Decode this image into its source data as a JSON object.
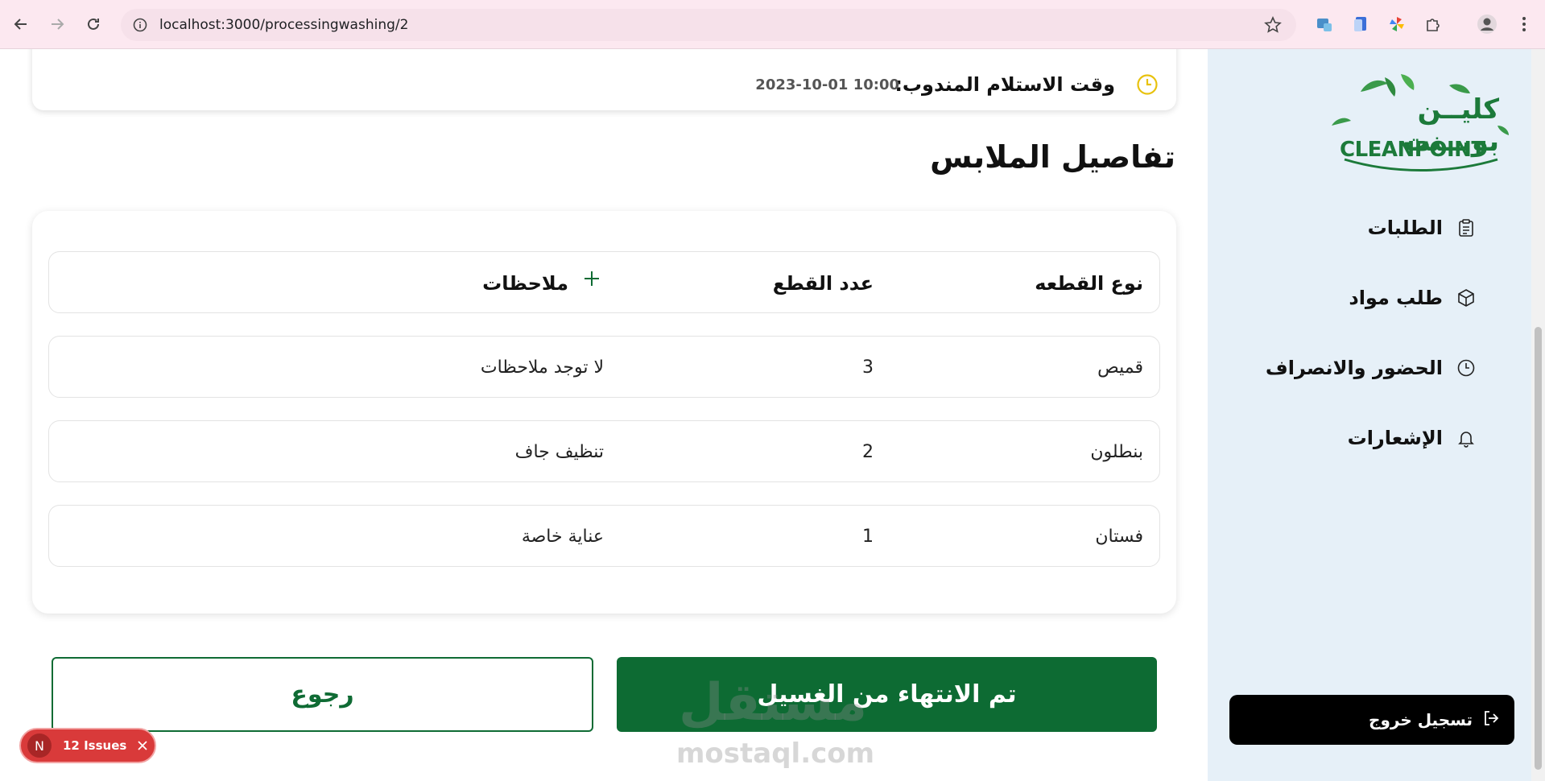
{
  "browser": {
    "url": "localhost:3000/processingwashing/2"
  },
  "pickup": {
    "label": "وقت الاستلام المندوب:",
    "value": "2023-10-01 10:00"
  },
  "section_title": "تفاصيل الملابس",
  "table": {
    "headers": {
      "type": "نوع القطعه",
      "count": "عدد القطع",
      "notes": "ملاحظات"
    },
    "rows": [
      {
        "type": "قميص",
        "count": "3",
        "notes": "لا توجد ملاحظات"
      },
      {
        "type": "بنطلون",
        "count": "2",
        "notes": "تنظيف جاف"
      },
      {
        "type": "فستان",
        "count": "1",
        "notes": "عناية خاصة"
      }
    ]
  },
  "buttons": {
    "back": "رجوع",
    "done": "تم الانتهاء من الغسيل"
  },
  "sidebar": {
    "logo_ar": "كليــن بويــنت",
    "logo_en": "CLEANPOINT",
    "items": [
      {
        "label": "الطلبات",
        "icon": "clipboard-icon"
      },
      {
        "label": "طلب مواد",
        "icon": "box-icon"
      },
      {
        "label": "الحضور والانصراف",
        "icon": "clock-icon"
      },
      {
        "label": "الإشعارات",
        "icon": "bell-icon"
      }
    ],
    "logout": "تسجيل خروج"
  },
  "dev_overlay": {
    "badge": "N",
    "issues": "12 Issues"
  },
  "watermark": {
    "ar": "مستقل",
    "en": "mostaql.com"
  },
  "colors": {
    "primary": "#0d6b33",
    "sidebar_bg": "#e6f0f8",
    "chrome_bg": "#fce8f0",
    "issues_bg": "#d93a3a"
  }
}
